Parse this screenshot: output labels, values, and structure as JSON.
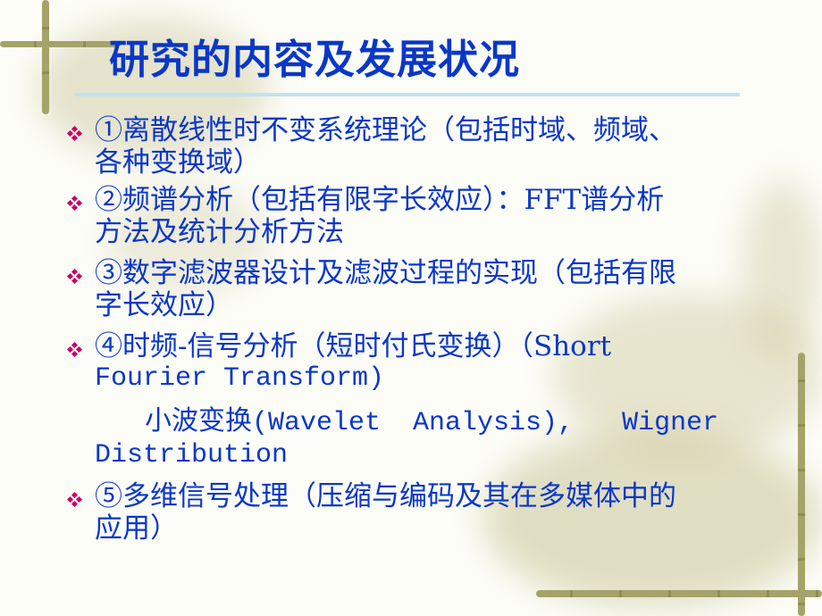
{
  "slide": {
    "title": "研究的内容及发展状况",
    "items": [
      {
        "lines": [
          "①离散线性时不变系统理论（包括时域、频域、",
          "各种变换域）"
        ]
      },
      {
        "lines": [
          "②频谱分析（包括有限字长效应）：FFT谱分析",
          "方法及统计分析方法"
        ]
      },
      {
        "lines": [
          "③数字滤波器设计及滤波过程的实现（包括有限",
          "字长效应）"
        ]
      },
      {
        "lines": [
          "④时频-信号分析（短时付氏变换）（Short",
          "Fourier Transform)"
        ]
      },
      {
        "lines": [
          "小波变换(Wavelet  Analysis),   Wigner",
          "Distribution"
        ]
      },
      {
        "lines": [
          "⑤多维信号处理（压缩与编码及其在多媒体中的",
          "应用）"
        ]
      }
    ]
  },
  "colors": {
    "title": "#0a37c9",
    "text": "#0a37c9",
    "bullet": "#cc0066",
    "rule": "#bfe2f3",
    "vine": "#a4a36a"
  }
}
